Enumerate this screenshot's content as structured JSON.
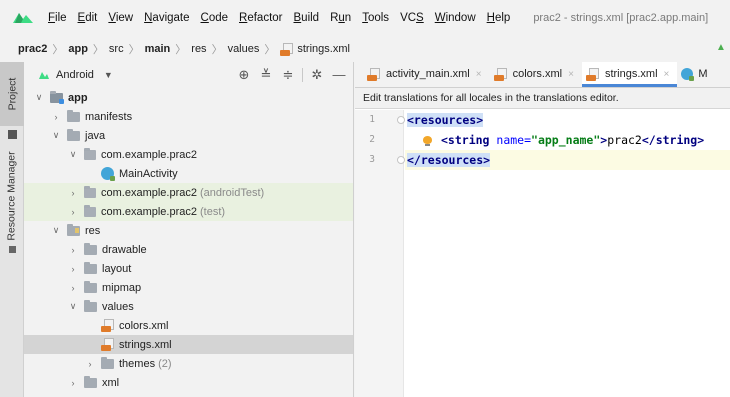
{
  "menubar": {
    "items": [
      {
        "label": "File",
        "u": "F",
        "rest": "ile"
      },
      {
        "label": "Edit",
        "u": "E",
        "rest": "dit"
      },
      {
        "label": "View",
        "u": "V",
        "rest": "iew"
      },
      {
        "label": "Navigate",
        "u": "N",
        "rest": "avigate"
      },
      {
        "label": "Code",
        "u": "C",
        "rest": "ode"
      },
      {
        "label": "Refactor",
        "u": "R",
        "rest": "efactor"
      },
      {
        "label": "Build",
        "u": "B",
        "rest": "uild"
      },
      {
        "label": "Run",
        "pre": "R",
        "u": "u",
        "rest": "n"
      },
      {
        "label": "Tools",
        "u": "T",
        "rest": "ools"
      },
      {
        "label": "VCS",
        "pre": "VC",
        "u": "S",
        "rest": ""
      },
      {
        "label": "Window",
        "u": "W",
        "rest": "indow"
      },
      {
        "label": "Help",
        "u": "H",
        "rest": "elp"
      }
    ],
    "window_title": "prac2 - strings.xml [prac2.app.main]"
  },
  "breadcrumb": {
    "items": [
      "prac2",
      "app",
      "src",
      "main",
      "res",
      "values",
      "strings.xml"
    ]
  },
  "stripe": {
    "project_label": "Project",
    "resource_manager_label": "Resource Manager"
  },
  "project_panel": {
    "view_label": "Android",
    "tree": [
      {
        "label": "app",
        "level": 0,
        "arrow": "down",
        "icon": "module-folder",
        "bold": true
      },
      {
        "label": "manifests",
        "level": 1,
        "arrow": "right",
        "icon": "folder"
      },
      {
        "label": "java",
        "level": 1,
        "arrow": "down",
        "icon": "folder"
      },
      {
        "label": "com.example.prac2",
        "level": 2,
        "arrow": "down",
        "icon": "package"
      },
      {
        "label": "MainActivity",
        "level": 3,
        "arrow": "none",
        "icon": "kotlin-class"
      },
      {
        "label": "com.example.prac2",
        "suffix": "(androidTest)",
        "level": 2,
        "arrow": "right",
        "icon": "package",
        "highlight": "green"
      },
      {
        "label": "com.example.prac2",
        "suffix": "(test)",
        "level": 2,
        "arrow": "right",
        "icon": "package",
        "highlight": "green"
      },
      {
        "label": "res",
        "level": 1,
        "arrow": "down",
        "icon": "res-folder"
      },
      {
        "label": "drawable",
        "level": 2,
        "arrow": "right",
        "icon": "folder"
      },
      {
        "label": "layout",
        "level": 2,
        "arrow": "right",
        "icon": "folder"
      },
      {
        "label": "mipmap",
        "level": 2,
        "arrow": "right",
        "icon": "folder"
      },
      {
        "label": "values",
        "level": 2,
        "arrow": "down",
        "icon": "folder"
      },
      {
        "label": "colors.xml",
        "level": 3,
        "arrow": "none",
        "icon": "xml-file"
      },
      {
        "label": "strings.xml",
        "level": 3,
        "arrow": "none",
        "icon": "xml-file",
        "selected": true
      },
      {
        "label": "themes",
        "suffix": "(2)",
        "level": 3,
        "arrow": "right",
        "icon": "folder"
      },
      {
        "label": "xml",
        "level": 2,
        "arrow": "right",
        "icon": "folder"
      }
    ]
  },
  "editor": {
    "tabs": [
      {
        "label": "activity_main.xml",
        "icon": "xml-file"
      },
      {
        "label": "colors.xml",
        "icon": "xml-file"
      },
      {
        "label": "strings.xml",
        "icon": "xml-file",
        "active": true
      },
      {
        "label": "M",
        "icon": "kotlin-class"
      }
    ],
    "banner": "Edit translations for all locales in the translations editor.",
    "line_numbers": [
      "1",
      "2",
      "3"
    ],
    "code": {
      "line1_tag": "<resources>",
      "line2_open": "<string",
      "line2_attr": "name=",
      "line2_val": "\"app_name\"",
      "line2_gt": ">",
      "line2_text": "prac2",
      "line2_close": "</string>",
      "line3_tag": "</resources>"
    }
  }
}
